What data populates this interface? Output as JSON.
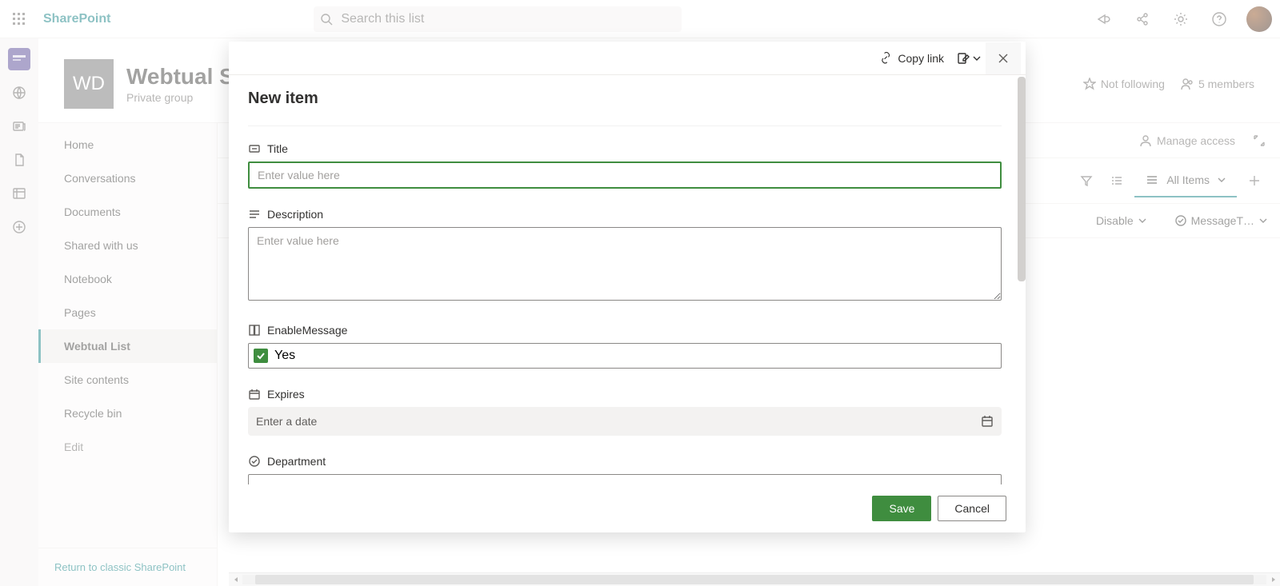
{
  "top": {
    "brand": "SharePoint",
    "searchPlaceholder": "Search this list"
  },
  "site": {
    "tile": "WD",
    "title": "Webtual SE",
    "subtitle": "Private group",
    "follow": "Not following",
    "members": "5 members"
  },
  "nav": {
    "items": [
      {
        "label": "Home"
      },
      {
        "label": "Conversations"
      },
      {
        "label": "Documents"
      },
      {
        "label": "Shared with us"
      },
      {
        "label": "Notebook"
      },
      {
        "label": "Pages"
      },
      {
        "label": "Webtual List"
      },
      {
        "label": "Site contents"
      },
      {
        "label": "Recycle bin"
      },
      {
        "label": "Edit"
      }
    ],
    "returnLink": "Return to classic SharePoint"
  },
  "cmd": {
    "manageAccess": "Manage access",
    "viewName": "All Items"
  },
  "columns": {
    "disable": "Disable",
    "messageT": "MessageT…"
  },
  "modal": {
    "copyLink": "Copy link",
    "title": "New item",
    "fields": {
      "title": {
        "label": "Title",
        "placeholder": "Enter value here"
      },
      "description": {
        "label": "Description",
        "placeholder": "Enter value here"
      },
      "enableMessage": {
        "label": "EnableMessage",
        "value": "Yes"
      },
      "expires": {
        "label": "Expires",
        "placeholder": "Enter a date"
      },
      "department": {
        "label": "Department",
        "value": "—"
      }
    },
    "save": "Save",
    "cancel": "Cancel"
  }
}
